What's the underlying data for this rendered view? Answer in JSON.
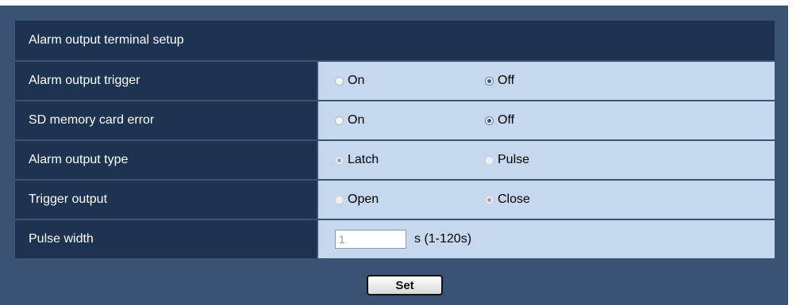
{
  "header": {
    "title": "Alarm output terminal setup"
  },
  "rows": [
    {
      "label": "Alarm output trigger",
      "opt1": "On",
      "opt2": "Off",
      "selected": "Off"
    },
    {
      "label": "SD memory card error",
      "opt1": "On",
      "opt2": "Off",
      "selected": "Off"
    },
    {
      "label": "Alarm output type",
      "opt1": "Latch",
      "opt2": "Pulse",
      "selected": "Latch"
    },
    {
      "label": "Trigger output",
      "opt1": "Open",
      "opt2": "Close",
      "selected": "Close"
    }
  ],
  "pulse": {
    "label": "Pulse width",
    "value": "1",
    "unit": "s (1-120s)"
  },
  "buttons": {
    "set": "Set"
  },
  "colors": {
    "header_bg": "#1c3352",
    "panel_bg": "#3a5274",
    "value_bg": "#c6d8ee",
    "radio_dot": "#1a56c2"
  }
}
